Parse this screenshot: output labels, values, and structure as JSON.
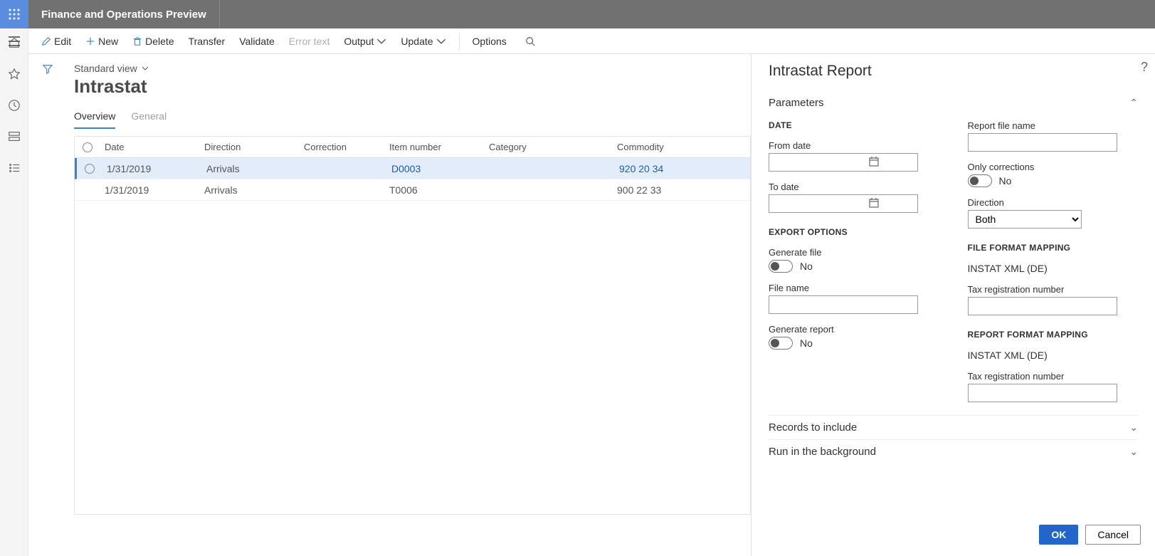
{
  "app_title": "Finance and Operations Preview",
  "commands": {
    "edit": "Edit",
    "new": "New",
    "delete": "Delete",
    "transfer": "Transfer",
    "validate": "Validate",
    "error_text": "Error text",
    "output": "Output",
    "update": "Update",
    "options": "Options"
  },
  "page": {
    "view": "Standard view",
    "title": "Intrastat",
    "tabs": {
      "overview": "Overview",
      "general": "General"
    }
  },
  "grid": {
    "headers": {
      "date": "Date",
      "direction": "Direction",
      "correction": "Correction",
      "item_number": "Item number",
      "category": "Category",
      "commodity": "Commodity"
    },
    "rows": [
      {
        "date": "1/31/2019",
        "direction": "Arrivals",
        "correction": "",
        "item_number": "D0003",
        "category": "",
        "commodity": "920 20 34",
        "selected": true
      },
      {
        "date": "1/31/2019",
        "direction": "Arrivals",
        "correction": "",
        "item_number": "T0006",
        "category": "",
        "commodity": "900 22 33",
        "selected": false
      }
    ]
  },
  "panel": {
    "title": "Intrastat Report",
    "sections": {
      "parameters": "Parameters",
      "records": "Records to include",
      "background": "Run in the background"
    },
    "date_group": "DATE",
    "from_date": "From date",
    "to_date": "To date",
    "export_options": "EXPORT OPTIONS",
    "generate_file": "Generate file",
    "file_name": "File name",
    "generate_report": "Generate report",
    "report_file_name": "Report file name",
    "only_corrections": "Only corrections",
    "direction_label": "Direction",
    "direction_value": "Both",
    "file_format_mapping": "FILE FORMAT MAPPING",
    "file_format_value": "INSTAT XML (DE)",
    "tax_reg_number": "Tax registration number",
    "report_format_mapping": "REPORT FORMAT MAPPING",
    "report_format_value": "INSTAT XML (DE)",
    "no": "No",
    "ok": "OK",
    "cancel": "Cancel"
  }
}
